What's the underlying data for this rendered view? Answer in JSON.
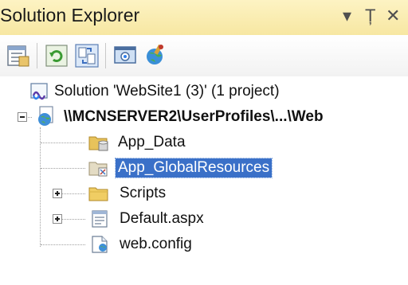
{
  "panel": {
    "title": "Solution Explorer",
    "controls": {
      "dropdown": "▾",
      "pin": "Ț",
      "close": "✕"
    }
  },
  "toolbar": {
    "items": [
      "properties-icon",
      "refresh-icon",
      "copy-website-icon",
      "view-designer-icon",
      "asp-config-icon"
    ]
  },
  "tree": {
    "solution_label": "Solution 'WebSite1 (3)' (1 project)",
    "project_label": "\\\\MCNSERVER2\\UserProfiles\\...\\Web",
    "items": [
      {
        "label": "App_Data"
      },
      {
        "label": "App_GlobalResources"
      },
      {
        "label": "Scripts"
      },
      {
        "label": "Default.aspx"
      },
      {
        "label": "web.config"
      }
    ]
  },
  "colors": {
    "title_bar": "#f7e7a2",
    "selection": "#3a70c8"
  }
}
